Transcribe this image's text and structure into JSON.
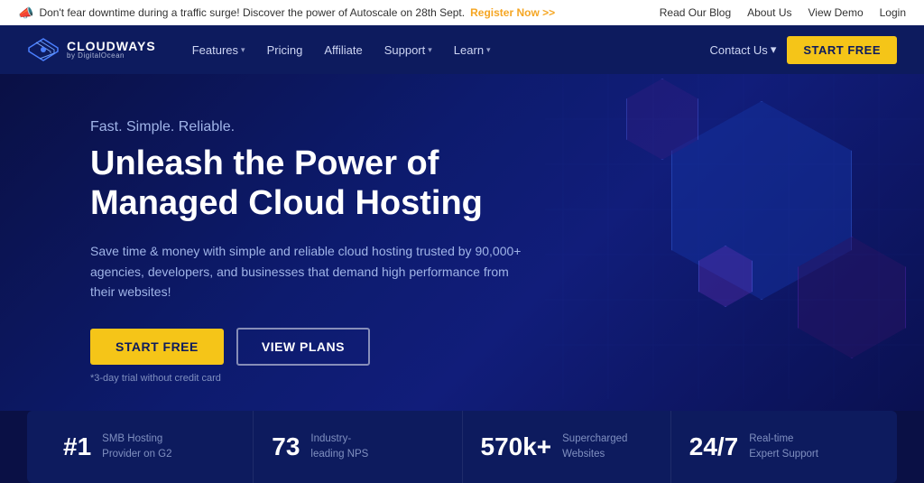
{
  "announcement": {
    "text": "Don't fear downtime during a traffic surge! Discover the power of Autoscale on 28th Sept.",
    "cta": "Register Now >>",
    "links": [
      "Read Our Blog",
      "About Us",
      "View Demo",
      "Login"
    ]
  },
  "navbar": {
    "logo_brand": "CLOUDWAYS",
    "logo_sub": "by DigitalOcean",
    "nav_items": [
      {
        "label": "Features",
        "has_dropdown": true
      },
      {
        "label": "Pricing",
        "has_dropdown": false
      },
      {
        "label": "Affiliate",
        "has_dropdown": false
      },
      {
        "label": "Support",
        "has_dropdown": true
      },
      {
        "label": "Learn",
        "has_dropdown": true
      }
    ],
    "contact_us": "Contact Us",
    "start_free": "START FREE"
  },
  "hero": {
    "tagline": "Fast. Simple. Reliable.",
    "title": "Unleash the Power of Managed Cloud Hosting",
    "description": "Save time & money with simple and reliable cloud hosting trusted by 90,000+ agencies, developers, and businesses that demand high performance from their websites!",
    "btn_start": "START FREE",
    "btn_plans": "VIEW PLANS",
    "trial_note": "*3-day trial without credit card"
  },
  "stats": [
    {
      "number": "#1",
      "desc": "SMB Hosting Provider on G2"
    },
    {
      "number": "73",
      "desc": "Industry-leading NPS"
    },
    {
      "number": "570k+",
      "desc": "Supercharged Websites"
    },
    {
      "number": "24/7",
      "desc": "Real-time Expert Support"
    }
  ]
}
